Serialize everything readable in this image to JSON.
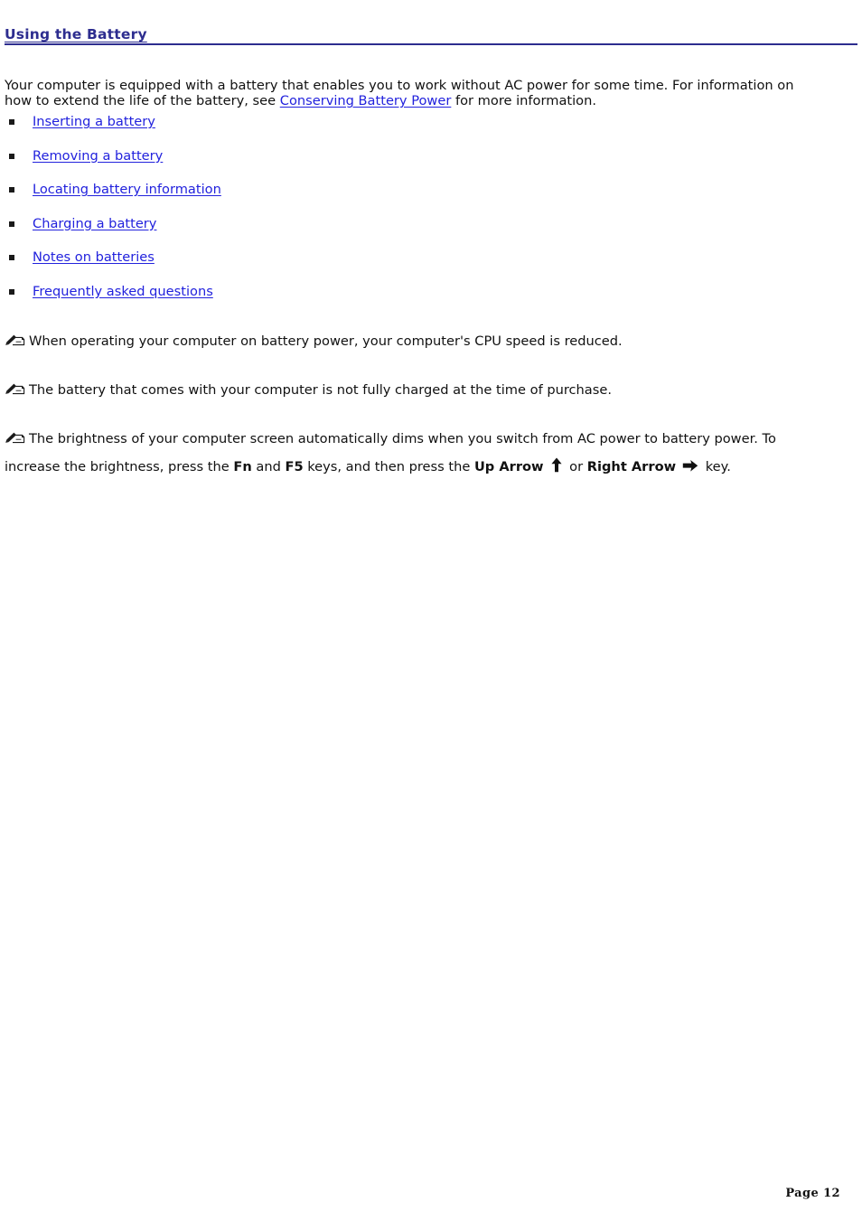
{
  "document": {
    "title": "Using the Battery",
    "accent_color": "#2d2d8f",
    "link_color": "#2222dd",
    "intro": {
      "line1": "Your computer is equipped with a battery that enables you to work without AC power for some time. For information on",
      "line2_before": "how to extend the life of the battery, see ",
      "link_text": "Conserving Battery Power",
      "line2_after": " for more information."
    },
    "links": [
      {
        "label": "Inserting a battery"
      },
      {
        "label": "Removing a battery"
      },
      {
        "label": "Locating battery information"
      },
      {
        "label": "Charging a battery"
      },
      {
        "label": "Notes on batteries"
      },
      {
        "label": "Frequently asked questions"
      }
    ],
    "notes": [
      {
        "icon": "note-pencil-icon",
        "text": "When operating your computer on battery power, your computer's CPU speed is reduced."
      },
      {
        "icon": "note-pencil-icon",
        "text": "The battery that comes with your computer is not fully charged at the time of purchase."
      },
      {
        "icon": "note-pencil-icon",
        "part1": "The brightness of your computer screen automatically dims when you switch from AC power to battery power. To increase the brightness, press the ",
        "key1": "Fn",
        "part2": " and ",
        "key2": "F5",
        "part3": " keys, and then press the ",
        "key3": "Up Arrow",
        "arrow1": "up-arrow-icon",
        "part4": " or ",
        "key4": "Right Arrow",
        "arrow2": "right-arrow-icon",
        "part5": " key."
      }
    ],
    "footer": {
      "page_label": "Page 12"
    }
  }
}
